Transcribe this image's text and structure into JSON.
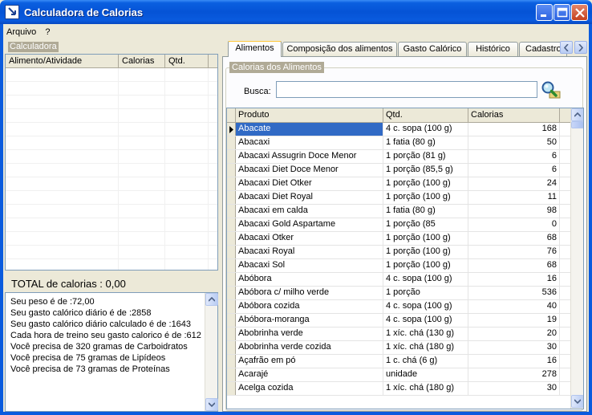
{
  "window": {
    "title": "Calculadora de Calorias"
  },
  "menu": [
    {
      "label": "Arquivo"
    },
    {
      "label": "?"
    }
  ],
  "calculator": {
    "group_label": "Calculadora",
    "columns": [
      {
        "label": "Alimento/Atividade"
      },
      {
        "label": "Calorias"
      },
      {
        "label": "Qtd."
      }
    ],
    "total_label": "TOTAL de calorias : 0,00",
    "info_lines": [
      "Seu peso é de :72,00",
      "Seu gasto calórico diário é de :2858",
      "Seu gasto calórico diário calculado é de :1643",
      "Cada hora de treino seu gasto calorico é de :612",
      "Você precisa de 320 gramas de Carboidratos",
      "Você precisa de  75 gramas de Lipídeos",
      "Você precisa de  73 gramas de Proteínas"
    ]
  },
  "tabs": [
    {
      "label": "Alimentos",
      "active": true
    },
    {
      "label": "Composição dos alimentos"
    },
    {
      "label": "Gasto Calórico"
    },
    {
      "label": "Histórico"
    },
    {
      "label": "Cadastro"
    }
  ],
  "foods_panel": {
    "group_label": "Calorias dos Alimentos",
    "search_label": "Busca:",
    "search_value": "",
    "columns": [
      {
        "label": "Produto"
      },
      {
        "label": "Qtd."
      },
      {
        "label": "Calorias"
      }
    ],
    "rows": [
      {
        "produto": "Abacate",
        "qtd": "4 c. sopa (100 g)",
        "calorias": "168"
      },
      {
        "produto": "Abacaxi",
        "qtd": "1 fatia (80 g)",
        "calorias": "50"
      },
      {
        "produto": "Abacaxi Assugrin Doce Menor",
        "qtd": "1 porção (81 g)",
        "calorias": "6"
      },
      {
        "produto": "Abacaxi Diet Doce Menor",
        "qtd": "1 porção (85,5 g)",
        "calorias": "6"
      },
      {
        "produto": "Abacaxi Diet Otker",
        "qtd": "1 porção (100 g)",
        "calorias": "24"
      },
      {
        "produto": "Abacaxi Diet Royal",
        "qtd": "1 porção (100 g)",
        "calorias": "11"
      },
      {
        "produto": "Abacaxi em calda",
        "qtd": "1 fatia (80 g)",
        "calorias": "98"
      },
      {
        "produto": "Abacaxi Gold Aspartame",
        "qtd": "1 porção (85",
        "calorias": "0"
      },
      {
        "produto": "Abacaxi Otker",
        "qtd": "1 porção (100 g)",
        "calorias": "68"
      },
      {
        "produto": "Abacaxi Royal",
        "qtd": "1 porção (100 g)",
        "calorias": "76"
      },
      {
        "produto": "Abacaxi Sol",
        "qtd": "1 porção (100 g)",
        "calorias": "68"
      },
      {
        "produto": "Abóbora",
        "qtd": "4 c. sopa (100 g)",
        "calorias": "16"
      },
      {
        "produto": "Abóbora c/ milho verde",
        "qtd": "1 porção",
        "calorias": "536"
      },
      {
        "produto": "Abóbora cozida",
        "qtd": "4 c. sopa (100 g)",
        "calorias": "40"
      },
      {
        "produto": "Abóbora-moranga",
        "qtd": "4 c. sopa (100 g)",
        "calorias": "19"
      },
      {
        "produto": "Abobrinha verde",
        "qtd": "1 xíc. chá (130 g)",
        "calorias": "20"
      },
      {
        "produto": "Abobrinha verde cozida",
        "qtd": "1 xíc. chá (180 g)",
        "calorias": "30"
      },
      {
        "produto": "Açafrão em pó",
        "qtd": "1 c. chá (6 g)",
        "calorias": "16"
      },
      {
        "produto": "Acarajé",
        "qtd": "unidade",
        "calorias": "278"
      },
      {
        "produto": "Acelga cozida",
        "qtd": "1 xíc. chá (180 g)",
        "calorias": "30"
      }
    ]
  },
  "colors": {
    "titlebar": "#0A5BDE",
    "selection": "#316AC5",
    "tab_highlight": "#FFC83C"
  },
  "icons": {
    "app": "calculator-app-icon",
    "minimize": "minimize-icon",
    "maximize": "maximize-icon",
    "close": "close-icon",
    "search": "magnifier-search-icon"
  }
}
